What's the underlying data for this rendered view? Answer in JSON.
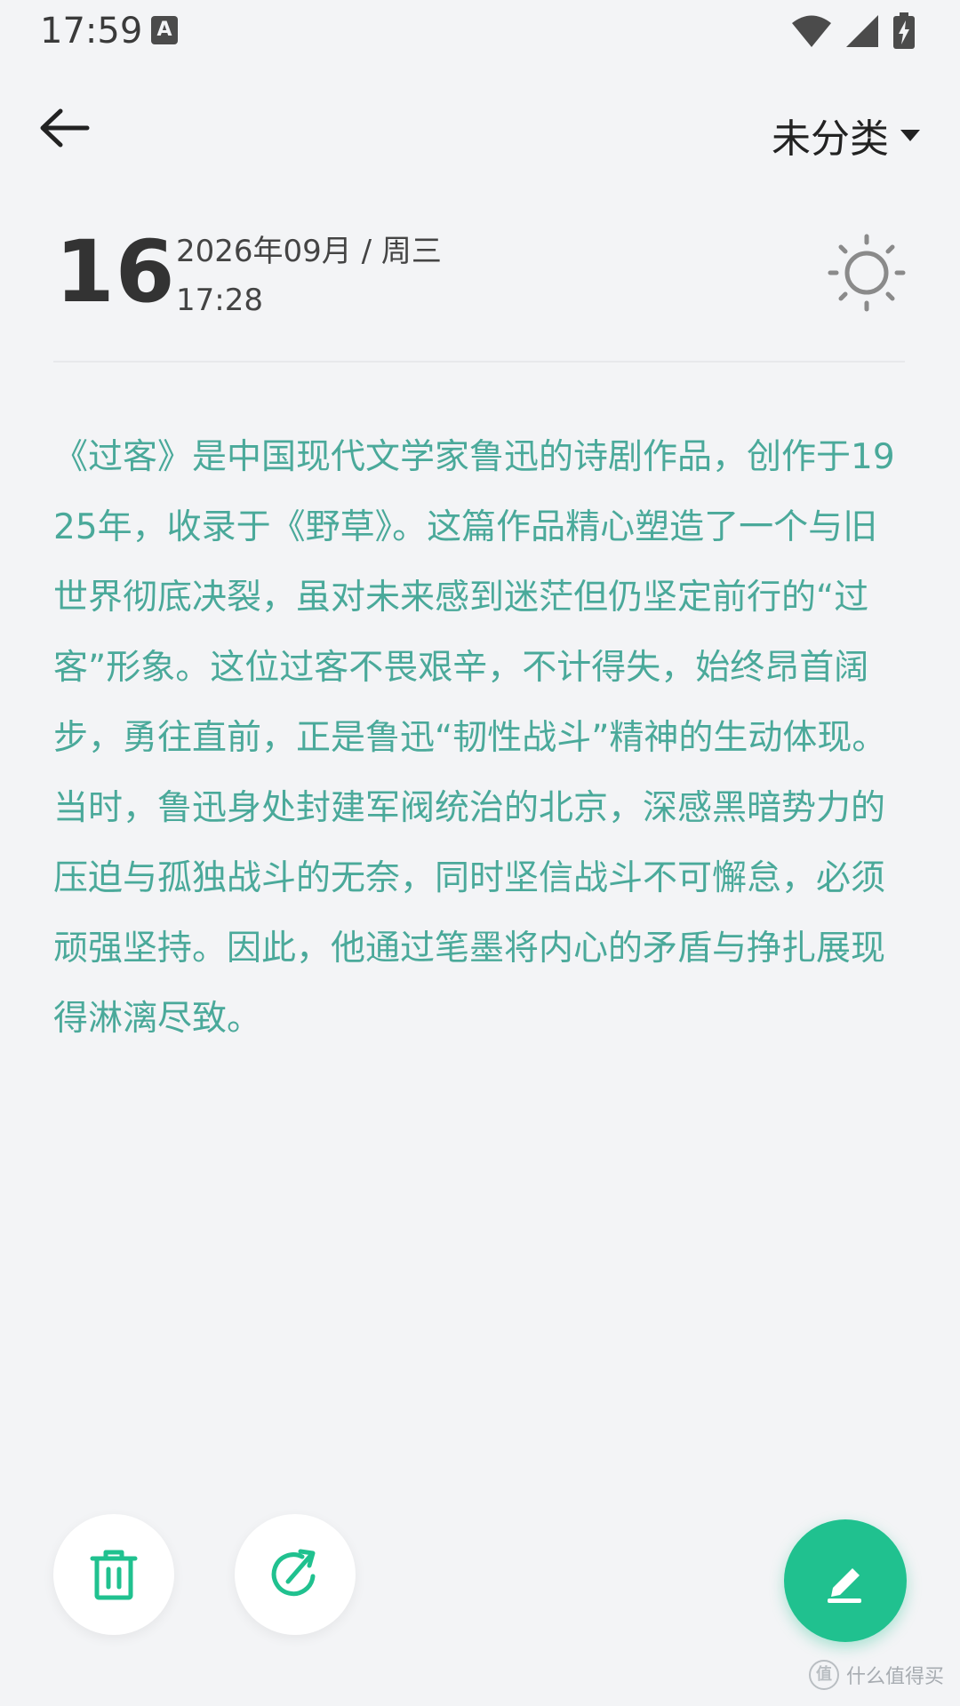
{
  "status_bar": {
    "time": "17:59",
    "input_indicator": "A",
    "icons": [
      "wifi-icon",
      "cellular-signal-icon",
      "battery-charging-icon"
    ]
  },
  "header": {
    "back_icon": "back-arrow-icon",
    "category_label": "未分类",
    "category_dropdown_icon": "caret-down-icon"
  },
  "entry": {
    "day": "16",
    "date": "2026年09月 / 周三",
    "time": "17:28",
    "weather_icon": "sun-icon",
    "body": "《过客》是中国现代文学家鲁迅的诗剧作品，创作于1925年，收录于《野草》。这篇作品精心塑造了一个与旧世界彻底决裂，虽对未来感到迷茫但仍坚定前行的“过客”形象。这位过客不畏艰辛，不计得失，始终昂首阔步，勇往直前，正是鲁迅“韧性战斗”精神的生动体现。当时，鲁迅身处封建军阀统治的北京，深感黑暗势力的压迫与孤独战斗的无奈，同时坚信战斗不可懈怠，必须顽强坚持。因此，他通过笔墨将内心的矛盾与挣扎展现得淋漓尽致。"
  },
  "actions": {
    "delete_icon": "trash-icon",
    "share_icon": "share-icon",
    "edit_icon": "edit-pencil-icon"
  },
  "watermark": {
    "logo": "值",
    "text": "什么值得买"
  },
  "colors": {
    "background": "#f3f4f6",
    "body_text": "#4aa99a",
    "accent": "#20c18f"
  }
}
